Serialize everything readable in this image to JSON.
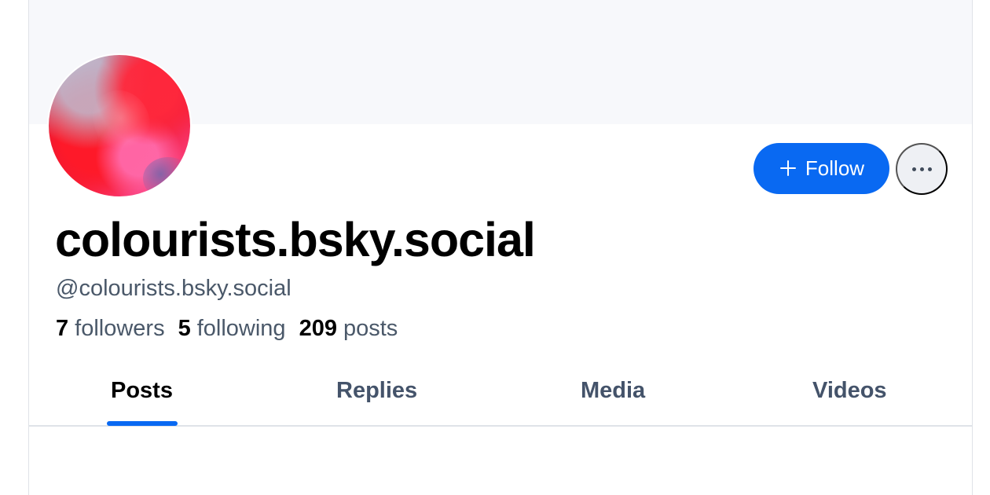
{
  "profile": {
    "display_name": "colourists.bsky.social",
    "handle": "@colourists.bsky.social",
    "follow_label": "Follow",
    "avatar_icon": "abstract-red-avatar-icon",
    "more_icon": "more-horizontal-icon",
    "plus_icon": "plus-icon",
    "stats": {
      "followers_count": "7",
      "followers_label": "followers",
      "following_count": "5",
      "following_label": "following",
      "posts_count": "209",
      "posts_label": "posts"
    },
    "tabs": [
      {
        "label": "Posts",
        "active": true
      },
      {
        "label": "Replies",
        "active": false
      },
      {
        "label": "Media",
        "active": false
      },
      {
        "label": "Videos",
        "active": false
      }
    ]
  },
  "colors": {
    "accent": "#0969f2",
    "text_primary": "#000000",
    "text_secondary": "#4a5869",
    "banner": "#f7f8fb",
    "border": "#dfe3e8"
  }
}
